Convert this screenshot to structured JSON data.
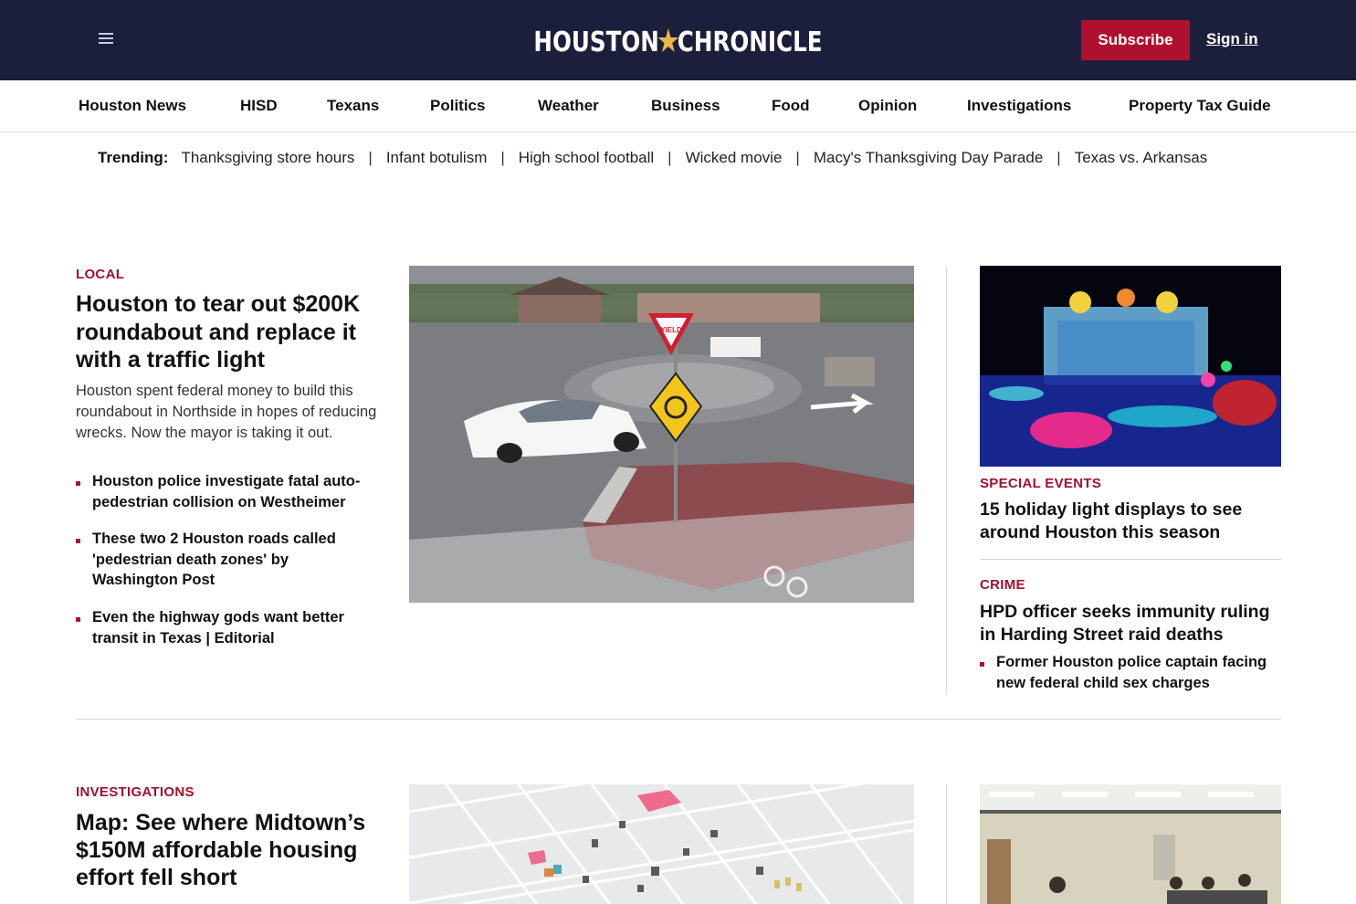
{
  "header": {
    "menu_icon": "hamburger-menu-icon",
    "logo_left": "HOUSTON",
    "logo_right": "CHRONICLE",
    "subscribe_label": "Subscribe",
    "signin_label": "Sign in"
  },
  "nav": {
    "items": [
      "Houston News",
      "HISD",
      "Texans",
      "Politics",
      "Weather",
      "Business",
      "Food",
      "Opinion",
      "Investigations",
      "Property Tax Guide"
    ]
  },
  "trending": {
    "label": "Trending:",
    "items": [
      "Thanksgiving store hours",
      "Infant botulism",
      "High school football",
      "Wicked movie",
      "Macy's Thanksgiving Day Parade",
      "Texas vs. Arkansas"
    ],
    "separator": "|"
  },
  "lead": {
    "kicker": "LOCAL",
    "headline": "Houston to tear out $200K roundabout and replace it with a traffic light",
    "dek": "Houston spent federal money to build this roundabout in Northside in hopes of reducing wrecks. Now the mayor is taking it out.",
    "related": [
      "Houston police investigate fatal auto-pedestrian collision on Westheimer",
      "These two 2 Houston roads called 'pedestrian death zones' by Washington Post",
      "Even the highway gods want better transit in Texas | Editorial"
    ],
    "sign_text": "YIELD"
  },
  "right_rail": {
    "story1": {
      "kicker": "SPECIAL EVENTS",
      "headline": "15 holiday light displays to see around Houston this season"
    },
    "story2": {
      "kicker": "CRIME",
      "headline": "HPD officer seeks immunity ruling in Harding Street raid deaths",
      "related": [
        "Former Houston police captain facing new federal child sex charges"
      ]
    }
  },
  "second": {
    "kicker": "INVESTIGATIONS",
    "headline": "Map: See where Midtown’s $150M affordable housing effort fell short"
  },
  "colors": {
    "header_bg": "#1b1f3b",
    "accent": "#b01030",
    "kicker": "#a3102c",
    "logo_star": "#e7b64a"
  }
}
